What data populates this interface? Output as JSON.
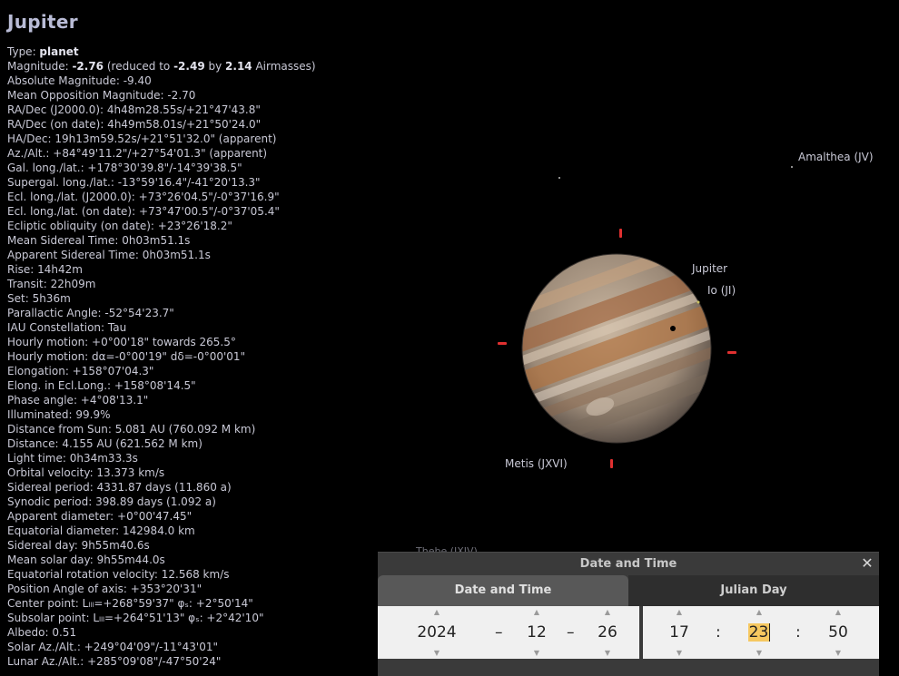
{
  "object": {
    "name": "Jupiter",
    "info_lines": [
      {
        "k": "Type: ",
        "v": "planet",
        "bold": true
      },
      {
        "k": "Magnitude: ",
        "mag": [
          "-2.76",
          " (reduced to ",
          "-2.49",
          " by ",
          "2.14",
          " Airmasses)"
        ]
      },
      {
        "k": "Absolute Magnitude: -9.40"
      },
      {
        "k": "Mean Opposition Magnitude: -2.70"
      },
      {
        "k": "RA/Dec (J2000.0): 4h48m28.55s/+21°47'43.8\""
      },
      {
        "k": "RA/Dec (on date): 4h49m58.01s/+21°50'24.0\""
      },
      {
        "k": "HA/Dec: 19h13m59.52s/+21°51'32.0\" (apparent)"
      },
      {
        "k": "Az./Alt.: +84°49'11.2\"/+27°54'01.3\" (apparent)"
      },
      {
        "k": "Gal. long./lat.: +178°30'39.8\"/-14°39'38.5\""
      },
      {
        "k": "Supergal. long./lat.: -13°59'16.4\"/-41°20'13.3\""
      },
      {
        "k": "Ecl. long./lat. (J2000.0): +73°26'04.5\"/-0°37'16.9\""
      },
      {
        "k": "Ecl. long./lat. (on date): +73°47'00.5\"/-0°37'05.4\""
      },
      {
        "k": "Ecliptic obliquity (on date): +23°26'18.2\""
      },
      {
        "k": "Mean Sidereal Time: 0h03m51.1s"
      },
      {
        "k": "Apparent Sidereal Time: 0h03m51.1s"
      },
      {
        "k": "Rise: 14h42m"
      },
      {
        "k": "Transit: 22h09m"
      },
      {
        "k": "Set: 5h36m"
      },
      {
        "k": "Parallactic Angle: -52°54'23.7\""
      },
      {
        "k": "IAU Constellation: Tau"
      },
      {
        "k": "Hourly motion: +0°00'18\" towards 265.5°"
      },
      {
        "k": "Hourly motion: dα=-0°00'19\" dδ=-0°00'01\""
      },
      {
        "k": "Elongation: +158°07'04.3\""
      },
      {
        "k": "Elong. in Ecl.Long.: +158°08'14.5\""
      },
      {
        "k": "Phase angle: +4°08'13.1\""
      },
      {
        "k": "Illuminated: 99.9%"
      },
      {
        "k": "Distance from Sun: 5.081 AU (760.092 M km)"
      },
      {
        "k": "Distance: 4.155 AU (621.562 M km)"
      },
      {
        "k": "Light time: 0h34m33.3s"
      },
      {
        "k": "Orbital velocity: 13.373 km/s"
      },
      {
        "k": "Sidereal period: 4331.87 days (11.860 a)"
      },
      {
        "k": "Synodic period: 398.89 days (1.092 a)"
      },
      {
        "k": "Apparent diameter: +0°00'47.45\""
      },
      {
        "k": "Equatorial diameter: 142984.0 km"
      },
      {
        "k": "Sidereal day: 9h55m40.6s"
      },
      {
        "k": "Mean solar day: 9h55m44.0s"
      },
      {
        "k": "Equatorial rotation velocity: 12.568 km/s"
      },
      {
        "k": "Position Angle of axis: +353°20'31\""
      },
      {
        "k": "Center point: Lₗₗₗ=+268°59'37\" φₛ: +2°50'14\""
      },
      {
        "k": "Subsolar point: Lₗₗₗ=+264°51'13\" φₛ: +2°42'10\""
      },
      {
        "k": "Albedo: 0.51"
      },
      {
        "k": "Solar Az./Alt.: +249°04'09\"/-11°43'01\""
      },
      {
        "k": "Lunar Az./Alt.: +285°09'08\"/-47°50'24\""
      }
    ]
  },
  "sky_labels": {
    "amalthea": "Amalthea (JV)",
    "jupiter": "Jupiter",
    "io": "Io (JI)",
    "metis": "Metis (JXVI)",
    "thebe": "Thebe (JXIV)"
  },
  "colors": {
    "marker": "#e03030",
    "panel_bg": "#f0f0f0",
    "selection": "#f6c860"
  },
  "dialog": {
    "title": "Date and Time",
    "close_icon": "close-icon",
    "tabs": [
      "Date and Time",
      "Julian Day"
    ],
    "date": {
      "year": "2024",
      "month": "12",
      "day": "26",
      "sep": "–"
    },
    "time": {
      "hour": "17",
      "minute": "23",
      "second": "50",
      "sep": ":"
    }
  }
}
